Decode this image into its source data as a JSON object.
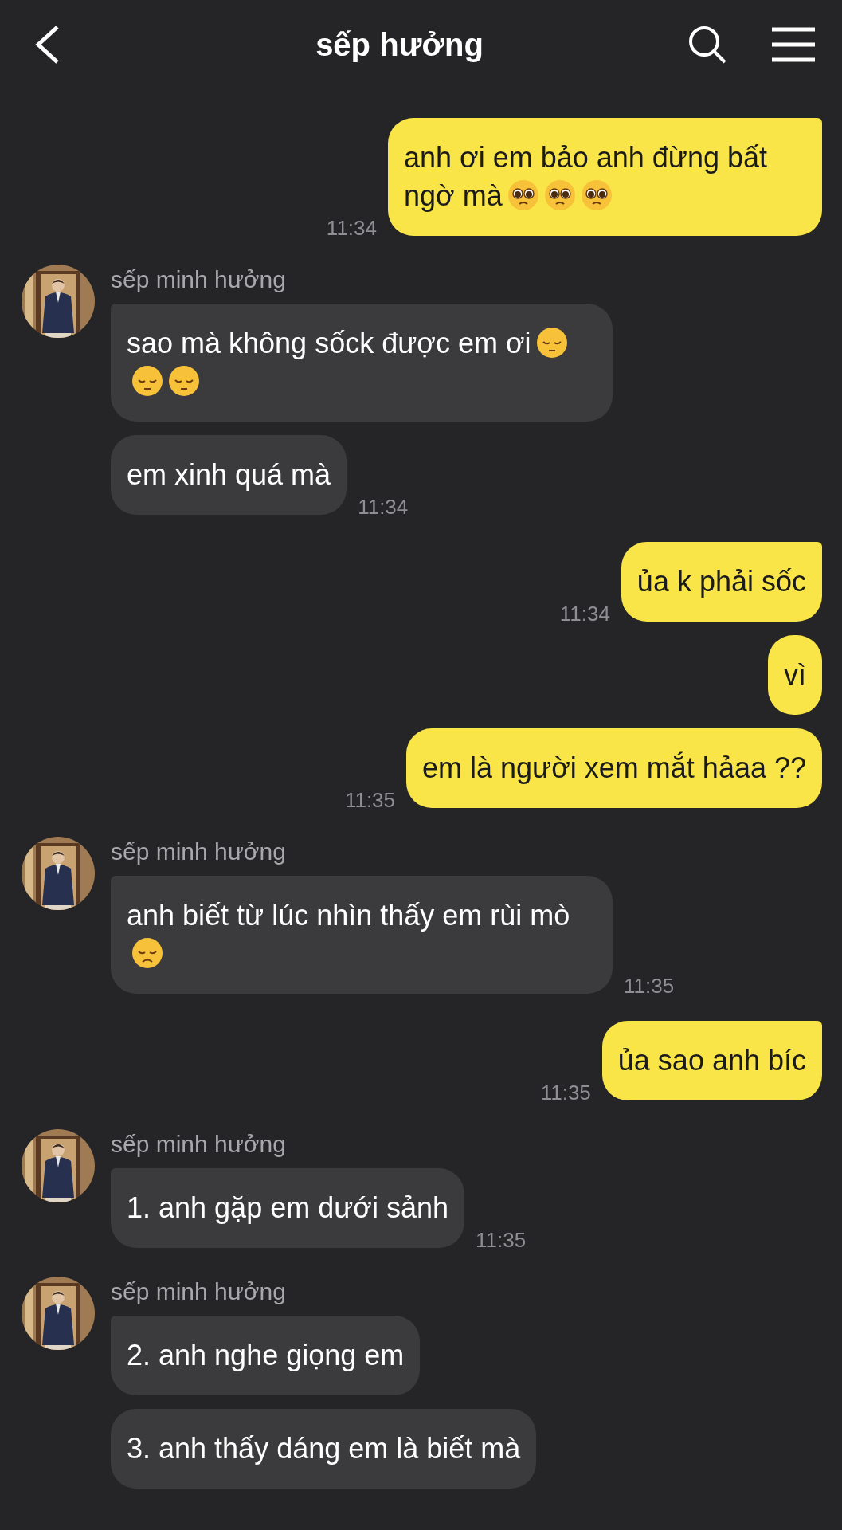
{
  "header": {
    "title": "sếp hưởng"
  },
  "groups": [
    {
      "kind": "outgoing",
      "messages": [
        {
          "text": "anh ơi em bảo anh đừng bất ngờ mà",
          "emojis": [
            {
              "kind": "pleading"
            },
            {
              "kind": "pleading"
            },
            {
              "kind": "pleading"
            }
          ],
          "time": "11:34"
        }
      ]
    },
    {
      "kind": "incoming",
      "sender": "sếp minh hưởng",
      "messages": [
        {
          "text": "sao mà không sốck được em ơi",
          "emojis": [
            {
              "kind": "pensive"
            },
            {
              "kind": "pensive"
            },
            {
              "kind": "pensive"
            }
          ]
        },
        {
          "text": "em xinh quá mà",
          "time": "11:34"
        }
      ]
    },
    {
      "kind": "outgoing",
      "messages": [
        {
          "text": "ủa k phải sốc",
          "time": "11:34"
        },
        {
          "text": "vì"
        },
        {
          "text": "em là người xem mắt hảaa ??",
          "time": "11:35"
        }
      ]
    },
    {
      "kind": "incoming",
      "sender": "sếp minh hưởng",
      "messages": [
        {
          "text": "anh biết từ lúc nhìn thấy em rùi mò",
          "emojis": [
            {
              "kind": "disappointed"
            }
          ],
          "time": "11:35"
        }
      ]
    },
    {
      "kind": "outgoing",
      "messages": [
        {
          "text": "ủa sao anh bíc",
          "time": "11:35"
        }
      ]
    },
    {
      "kind": "incoming",
      "sender": "sếp minh hưởng",
      "messages": [
        {
          "text": "1. anh gặp em dưới sảnh",
          "time": "11:35"
        }
      ]
    },
    {
      "kind": "incoming",
      "sender": "sếp minh hưởng",
      "messages": [
        {
          "text": "2. anh nghe giọng em"
        },
        {
          "text": "3. anh thấy dáng em là biết mà"
        }
      ]
    }
  ]
}
